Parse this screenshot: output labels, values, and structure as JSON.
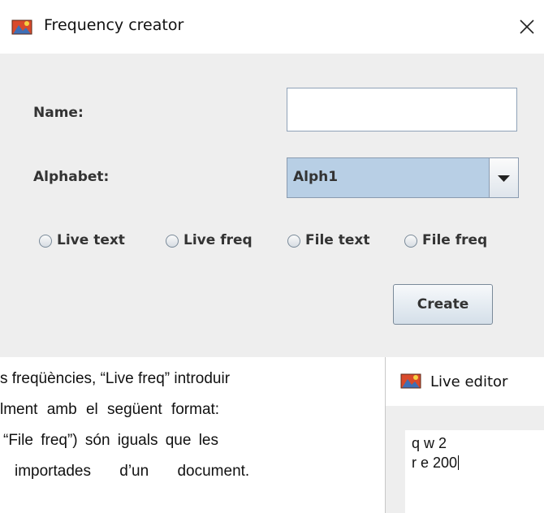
{
  "window": {
    "title": "Frequency creator",
    "close_glyph": "✕"
  },
  "form": {
    "name_label": "Name:",
    "name_value": "",
    "alphabet_label": "Alphabet:",
    "alphabet_selected": "Alph1",
    "radios": [
      {
        "label": "Live text",
        "selected": false
      },
      {
        "label": "Live freq",
        "selected": false
      },
      {
        "label": "File text",
        "selected": false
      },
      {
        "label": "File freq",
        "selected": false
      }
    ],
    "create_label": "Create"
  },
  "document": {
    "lines": [
      "s freqüències, “Live freq” introduir",
      "lment amb el següent format:",
      " “File freq”) són iguals que les",
      "importades d’un document."
    ]
  },
  "live_editor": {
    "title": "Live editor",
    "lines": [
      "q w 2",
      "r e 200"
    ]
  },
  "colors": {
    "panel_bg": "#eeeeee",
    "combo_bg": "#b8cfe5",
    "label_text": "#333333"
  },
  "icons": {
    "app": "java-duke-icon",
    "close": "close-icon",
    "dropdown": "triangle-down-icon"
  }
}
